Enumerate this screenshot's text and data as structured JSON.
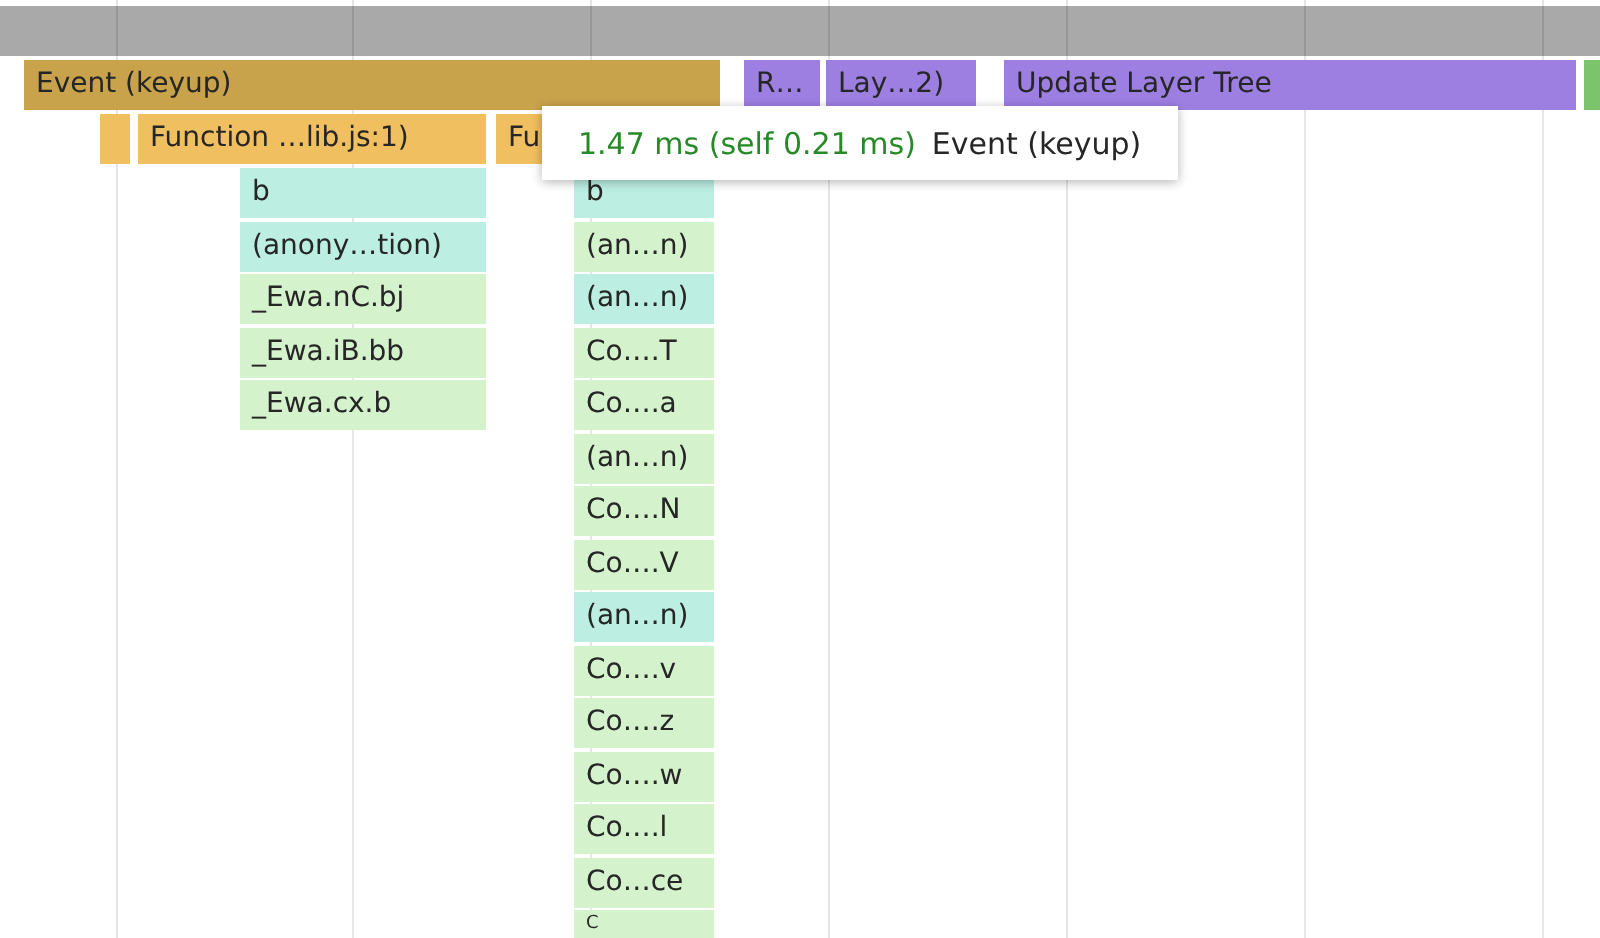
{
  "top_row": [
    {
      "label": "Event (keyup)",
      "color": "#c9a24c"
    },
    {
      "label": "R…",
      "color": "#9d7fe2"
    },
    {
      "label": "Lay…2)",
      "color": "#9d7fe2"
    },
    {
      "label": "Update Layer Tree",
      "color": "#9d7fe2"
    },
    {
      "color": "#7cc46c"
    }
  ],
  "second_row": [
    {
      "color": "#f0c060"
    },
    {
      "label": "Function …lib.js:1)",
      "color": "#f0c060"
    },
    {
      "label": "Fu",
      "color": "#f0c060"
    }
  ],
  "stacks": [
    {
      "frames": [
        {
          "label": "b",
          "color": "#bcefe2"
        },
        {
          "label": "(anony…tion)",
          "color": "#bcefe2"
        },
        {
          "label": "_Ewa.nC.bj",
          "color": "#d4f2cb"
        },
        {
          "label": "_Ewa.iB.bb",
          "color": "#d4f2cb"
        },
        {
          "label": "_Ewa.cx.b",
          "color": "#d4f2cb"
        }
      ]
    },
    {
      "frames": [
        {
          "label": "b",
          "color": "#bcefe2"
        },
        {
          "label": "(an…n)",
          "color": "#d4f2cb"
        },
        {
          "label": "(an…n)",
          "color": "#bcefe2"
        },
        {
          "label": "Co….T",
          "color": "#d4f2cb"
        },
        {
          "label": "Co….a",
          "color": "#d4f2cb"
        },
        {
          "label": "(an…n)",
          "color": "#d4f2cb"
        },
        {
          "label": "Co….N",
          "color": "#d4f2cb"
        },
        {
          "label": "Co….V",
          "color": "#d4f2cb"
        },
        {
          "label": "(an…n)",
          "color": "#bcefe2"
        },
        {
          "label": "Co….v",
          "color": "#d4f2cb"
        },
        {
          "label": "Co….z",
          "color": "#d4f2cb"
        },
        {
          "label": "Co….w",
          "color": "#d4f2cb"
        },
        {
          "label": "Co….l",
          "color": "#d4f2cb"
        },
        {
          "label": "Co…ce",
          "color": "#d4f2cb"
        },
        {
          "label": "C",
          "color": "#d4f2cb"
        }
      ]
    }
  ],
  "tooltip": {
    "duration": "1.47 ms (self 0.21 ms)",
    "name": "Event (keyup)"
  }
}
